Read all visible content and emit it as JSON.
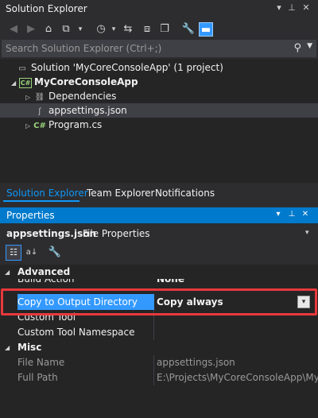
{
  "window": {
    "title": "Solution Explorer"
  },
  "search": {
    "placeholder": "Search Solution Explorer (Ctrl+;)"
  },
  "tree": {
    "solution": "Solution 'MyCoreConsoleApp' (1 project)",
    "project": "MyCoreConsoleApp",
    "dependencies": "Dependencies",
    "appsettings": "appsettings.json",
    "program": "Program.cs"
  },
  "tabs": [
    "Solution Explorer",
    "Team Explorer",
    "Notifications"
  ],
  "properties": {
    "title": "Properties",
    "object_name": "appsettings.json",
    "object_type": "File Properties",
    "advanced_label": "Advanced",
    "misc_label": "Misc",
    "rows": {
      "build_action": {
        "name": "Build Action",
        "value": "None"
      },
      "copy_output": {
        "name": "Copy to Output Directory",
        "value": "Copy always"
      },
      "custom_tool": {
        "name": "Custom Tool",
        "value": ""
      },
      "custom_ns": {
        "name": "Custom Tool Namespace",
        "value": ""
      },
      "file_name": {
        "name": "File Name",
        "value": "appsettings.json"
      },
      "full_path": {
        "name": "Full Path",
        "value": "E:\\Projects\\MyCoreConsoleApp\\MyCoreC"
      }
    }
  },
  "colors": {
    "accent": "#007acc",
    "highlight_border": "#e8393c",
    "selection": "#3399ff"
  }
}
